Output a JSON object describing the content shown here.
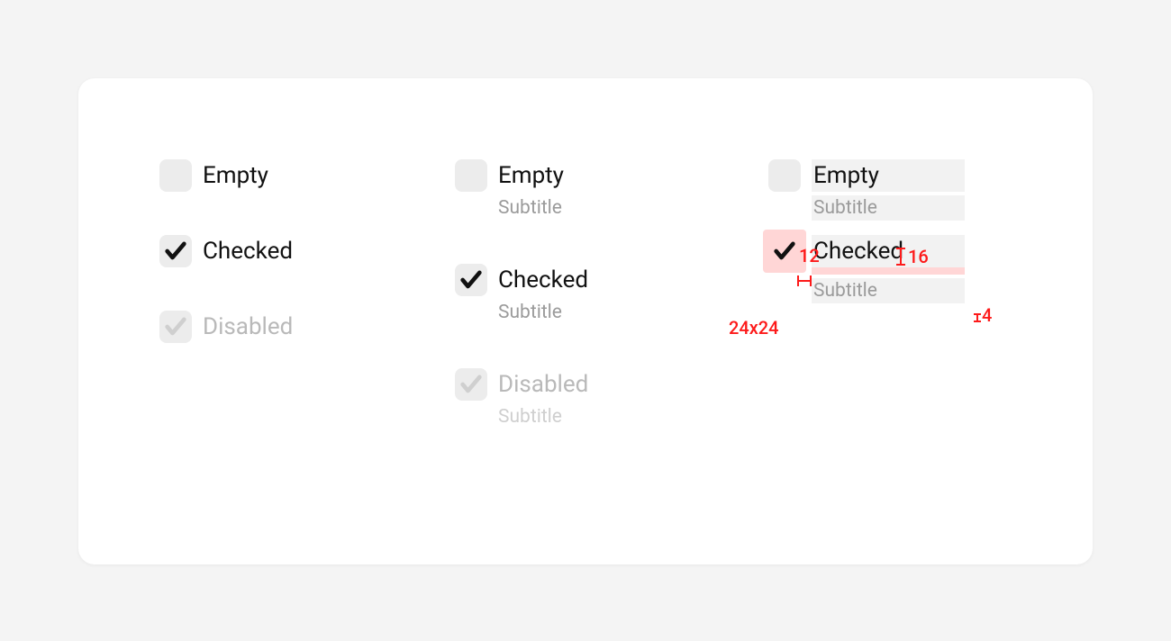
{
  "columns": {
    "simple": [
      {
        "state": "empty",
        "title": "Empty"
      },
      {
        "state": "checked",
        "title": "Checked"
      },
      {
        "state": "disabled",
        "title": "Disabled"
      }
    ],
    "with_subtitle": [
      {
        "state": "empty",
        "title": "Empty",
        "subtitle": "Subtitle"
      },
      {
        "state": "checked",
        "title": "Checked",
        "subtitle": "Subtitle"
      },
      {
        "state": "disabled",
        "title": "Disabled",
        "subtitle": "Subtitle"
      }
    ],
    "spec": [
      {
        "state": "empty",
        "title": "Empty",
        "subtitle": "Subtitle"
      },
      {
        "state": "checked",
        "title": "Checked",
        "subtitle": "Subtitle"
      }
    ]
  },
  "annotations": {
    "gap_box_to_text": "12",
    "gap_between_rows": "16",
    "box_size": "24x24",
    "gap_title_subtitle": "4"
  }
}
